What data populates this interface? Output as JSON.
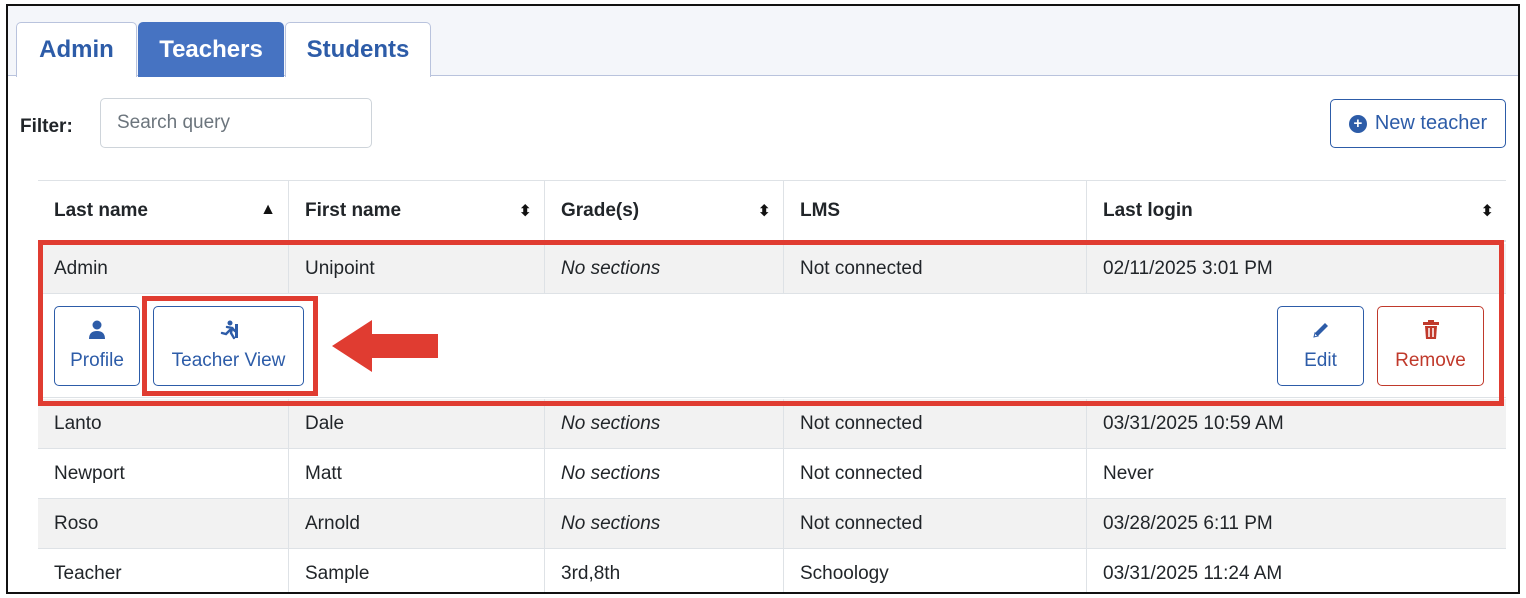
{
  "tabs": [
    {
      "label": "Admin",
      "active": false
    },
    {
      "label": "Teachers",
      "active": true
    },
    {
      "label": "Students",
      "active": false
    }
  ],
  "filter": {
    "label": "Filter:",
    "placeholder": "Search query",
    "value": ""
  },
  "new_teacher_button": {
    "label": "New teacher",
    "icon": "plus-circle-icon"
  },
  "table": {
    "headers": [
      "Last name",
      "First name",
      "Grade(s)",
      "LMS",
      "Last login"
    ],
    "sort_icons": [
      "sort-up-icon",
      "sort-icon",
      "sort-icon",
      "",
      "sort-icon"
    ],
    "rows": [
      [
        "Admin",
        "Unipoint",
        "No sections",
        "Not connected",
        "02/11/2025 3:01 PM"
      ],
      [
        "Lanto",
        "Dale",
        "No sections",
        "Not connected",
        "03/31/2025 10:59 AM"
      ],
      [
        "Newport",
        "Matt",
        "No sections",
        "Not connected",
        "Never"
      ],
      [
        "Roso",
        "Arnold",
        "No sections",
        "Not connected",
        "03/28/2025 6:11 PM"
      ],
      [
        "Teacher",
        "Sample",
        "3rd,8th",
        "Schoology",
        "03/31/2025 11:24 AM"
      ]
    ]
  },
  "row_actions": {
    "profile": {
      "label": "Profile",
      "icon": "user-icon"
    },
    "teacher_view": {
      "label": "Teacher View",
      "icon": "person-running-icon"
    },
    "edit": {
      "label": "Edit",
      "icon": "pencil-icon"
    },
    "remove": {
      "label": "Remove",
      "icon": "trash-icon"
    }
  },
  "colors": {
    "accent": "#2d5ca8",
    "active_tab": "#4673c2",
    "danger": "#c0392b",
    "annotation": "#e03c31",
    "stripe": "#f2f2f2"
  }
}
